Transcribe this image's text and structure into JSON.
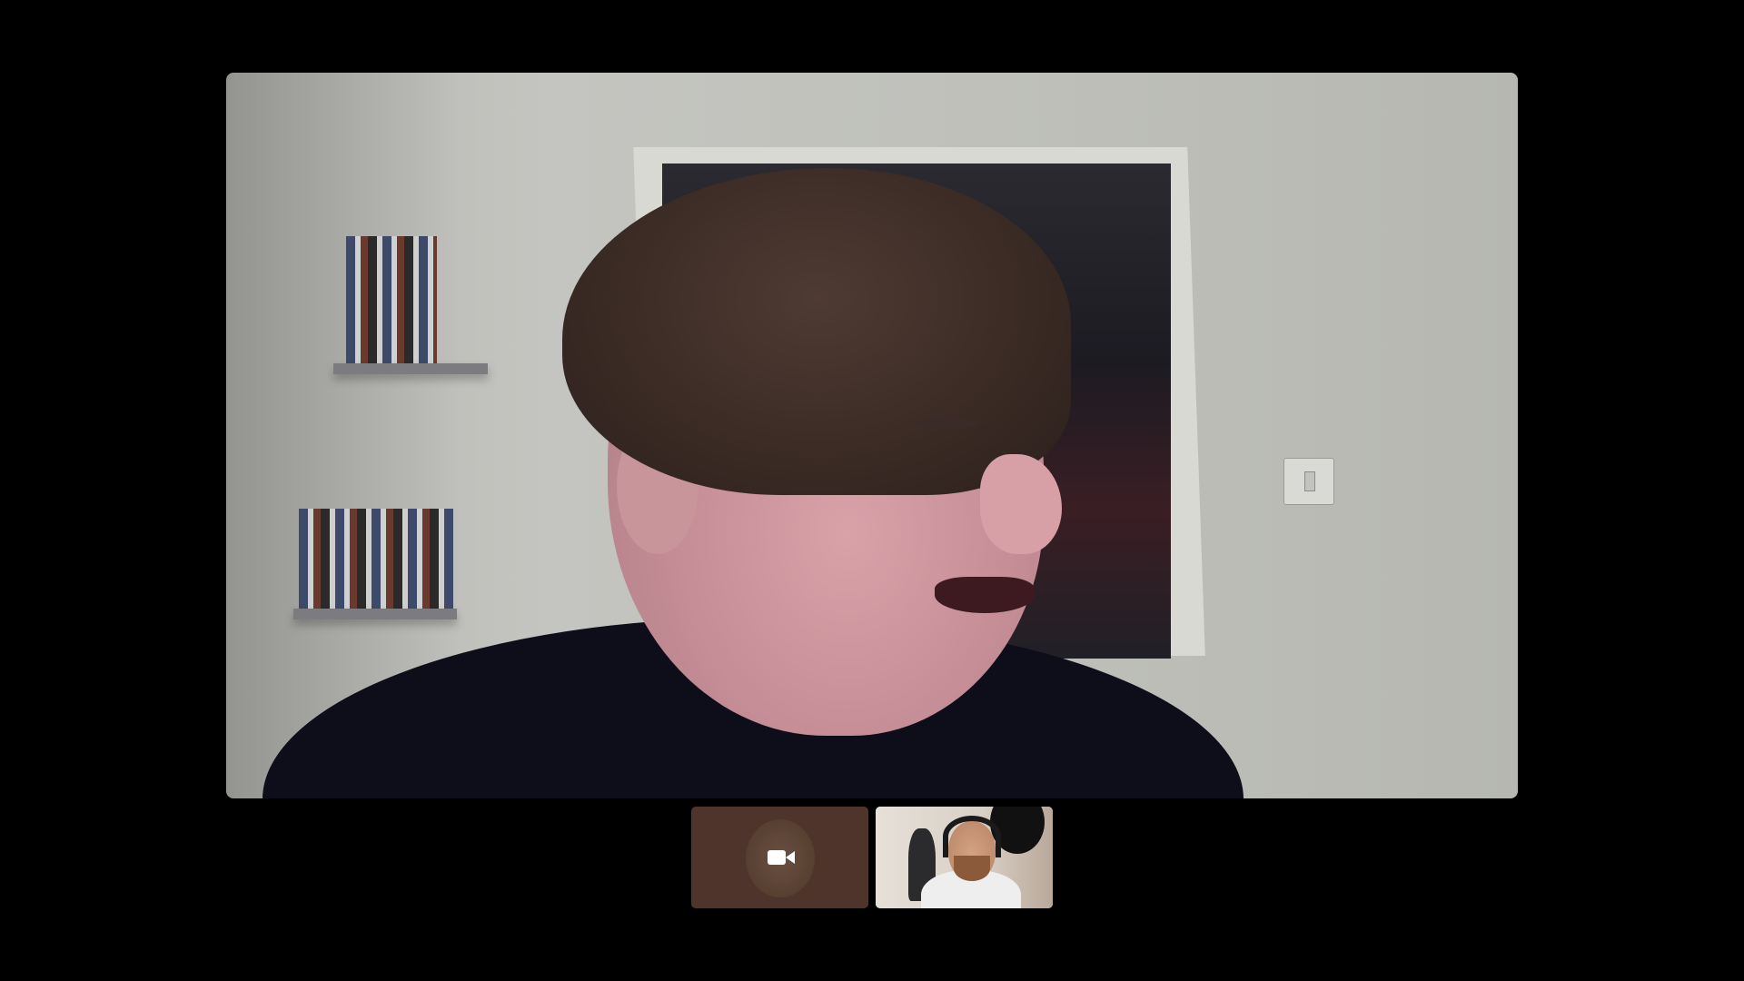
{
  "app": {
    "type": "video-call"
  },
  "main_video": {
    "participant": "remote-participant-1",
    "content": "speaker-video-feed"
  },
  "thumbnails": [
    {
      "id": "self-view",
      "camera_state": "camera-icon",
      "background_color": "#4e342a"
    },
    {
      "id": "remote-participant-2",
      "content": "participant-video-feed"
    }
  ],
  "colors": {
    "background": "#000000",
    "camera_icon": "#ffffff"
  }
}
